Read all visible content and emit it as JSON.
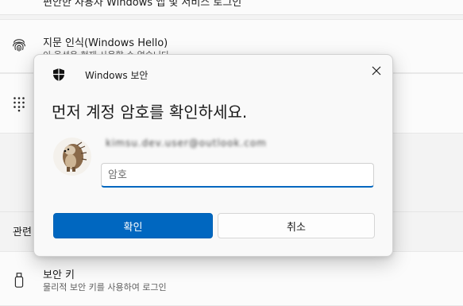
{
  "background": {
    "top_row_text": "편안한 사용자 Windows 앱 및 서비스 로그인",
    "fingerprint": {
      "title": "지문 인식(Windows Hello)",
      "subtitle": "이 옵션은 현재 사용할 수 없습니다",
      "icon": "fingerprint-icon"
    },
    "pin": {
      "icon": "pin-keypad-icon"
    },
    "related_label": "관련",
    "security_key": {
      "title": "보안 키",
      "subtitle": "물리적 보안 키를 사용하여 로그인",
      "icon": "usb-key-icon"
    }
  },
  "dialog": {
    "app_name": "Windows 보안",
    "title": "먼저 계정 암호를 확인하세요.",
    "account_name": "kimsu.dev.user@outlook.com",
    "password": {
      "placeholder": "암호",
      "value": ""
    },
    "ok_label": "확인",
    "cancel_label": "취소",
    "accent_color": "#0067c0"
  }
}
